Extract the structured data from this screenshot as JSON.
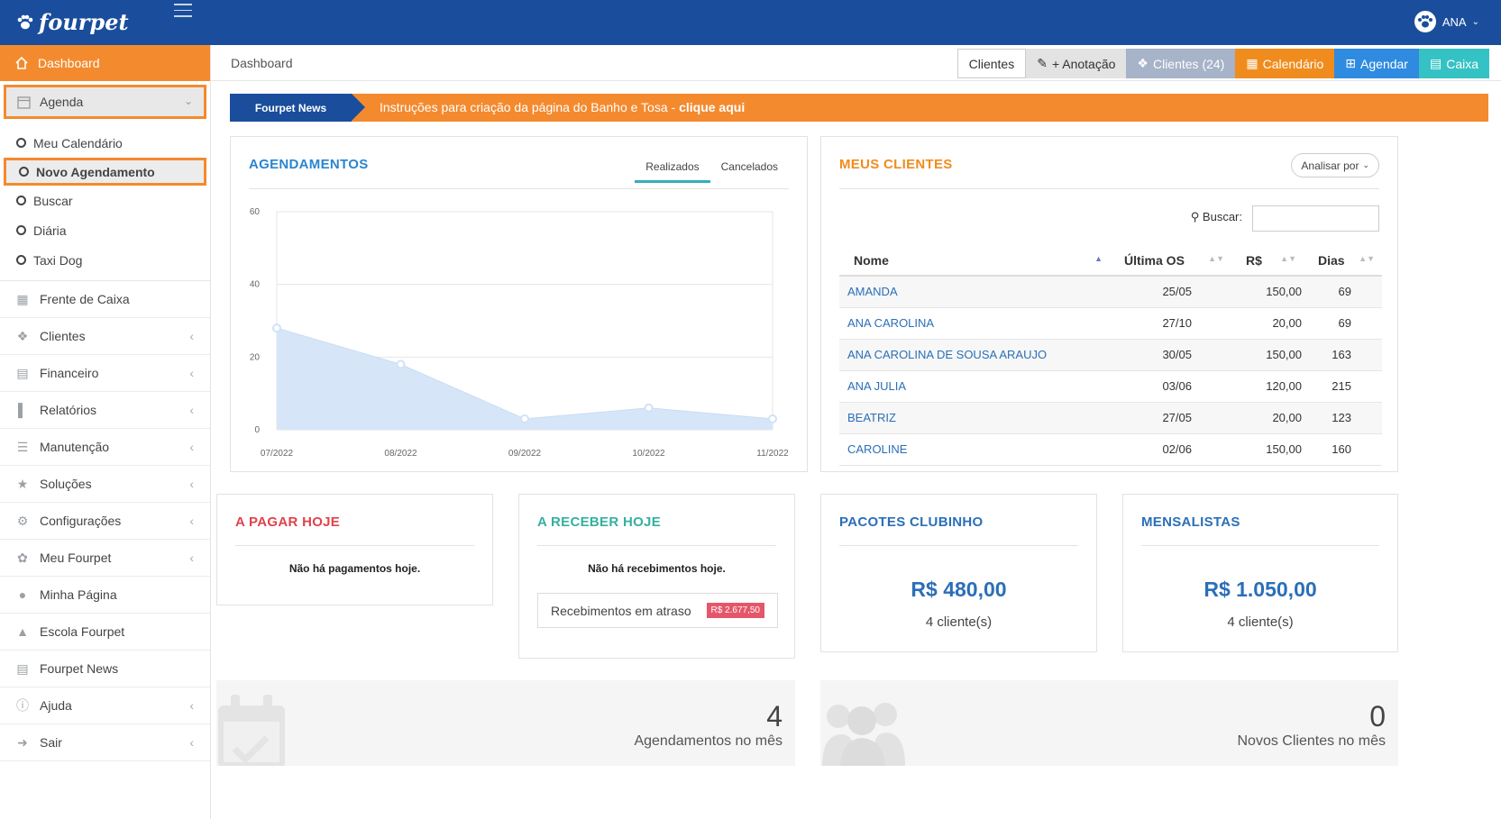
{
  "app": {
    "brand": "fourpet",
    "user": "ANA"
  },
  "sidebar": {
    "dashboard": "Dashboard",
    "agenda": "Agenda",
    "agenda_items": [
      "Meu Calendário",
      "Novo Agendamento",
      "Buscar",
      "Diária",
      "Taxi Dog"
    ],
    "menu": [
      {
        "label": "Frente de Caixa",
        "icon": "calculator-icon",
        "arrow": false
      },
      {
        "label": "Clientes",
        "icon": "users-icon",
        "arrow": true
      },
      {
        "label": "Financeiro",
        "icon": "money-icon",
        "arrow": true
      },
      {
        "label": "Relatórios",
        "icon": "bar-chart-icon",
        "arrow": true
      },
      {
        "label": "Manutenção",
        "icon": "database-icon",
        "arrow": true
      },
      {
        "label": "Soluções",
        "icon": "star-icon",
        "arrow": true
      },
      {
        "label": "Configurações",
        "icon": "cogs-icon",
        "arrow": true
      },
      {
        "label": "Meu Fourpet",
        "icon": "paw-icon",
        "arrow": true
      },
      {
        "label": "Minha Página",
        "icon": "globe-icon",
        "arrow": false
      },
      {
        "label": "Escola Fourpet",
        "icon": "graduation-cap-icon",
        "arrow": false
      },
      {
        "label": "Fourpet News",
        "icon": "newspaper-icon",
        "arrow": false
      },
      {
        "label": "Ajuda",
        "icon": "info-icon",
        "arrow": true
      },
      {
        "label": "Sair",
        "icon": "sign-out-icon",
        "arrow": true
      }
    ]
  },
  "header": {
    "breadcrumb": "Dashboard",
    "buttons": {
      "clientes": "Clientes",
      "anotacao": "+ Anotação",
      "clientes_count": "Clientes (24)",
      "calendario": "Calendário",
      "agendar": "Agendar",
      "caixa": "Caixa"
    }
  },
  "news": {
    "tag": "Fourpet News",
    "message": "Instruções para criação da página do Banho e Tosa - ",
    "link": "clique aqui"
  },
  "agendamentos": {
    "title": "AGENDAMENTOS",
    "tab_active": "Realizados",
    "tab_other": "Cancelados"
  },
  "chart_data": {
    "type": "area",
    "categories": [
      "07/2022",
      "08/2022",
      "09/2022",
      "10/2022",
      "11/2022"
    ],
    "values": [
      28,
      18,
      3,
      6,
      3
    ],
    "ylim": [
      0,
      60
    ],
    "yticks": [
      0,
      20,
      40,
      60
    ],
    "grid": true,
    "fill_color": "#d6e6f8",
    "point_color": "#cfe3f7"
  },
  "clientes": {
    "title": "MEUS CLIENTES",
    "analyze_label": "Analisar por",
    "search_label": "Buscar:",
    "search_value": "",
    "columns": [
      "Nome",
      "Última OS",
      "R$",
      "Dias"
    ],
    "rows": [
      {
        "nome": "AMANDA",
        "os": "25/05",
        "valor": "150,00",
        "dias": "69"
      },
      {
        "nome": "ANA CAROLINA",
        "os": "27/10",
        "valor": "20,00",
        "dias": "69"
      },
      {
        "nome": "ANA CAROLINA DE SOUSA ARAUJO",
        "os": "30/05",
        "valor": "150,00",
        "dias": "163"
      },
      {
        "nome": "ANA JULIA",
        "os": "03/06",
        "valor": "120,00",
        "dias": "215"
      },
      {
        "nome": "BEATRIZ",
        "os": "27/05",
        "valor": "20,00",
        "dias": "123"
      },
      {
        "nome": "CAROLINE",
        "os": "02/06",
        "valor": "150,00",
        "dias": "160"
      }
    ]
  },
  "pagar": {
    "title": "A PAGAR HOJE",
    "text": "Não há pagamentos hoje."
  },
  "receber": {
    "title": "A RECEBER HOJE",
    "text": "Não há recebimentos hoje.",
    "atraso_label": "Recebimentos em atraso",
    "atraso_value": "R$ 2.677,50"
  },
  "pacotes": {
    "title": "PACOTES CLUBINHO",
    "value": "R$ 480,00",
    "sub": "4 cliente(s)"
  },
  "mensalistas": {
    "title": "MENSALISTAS",
    "value": "R$ 1.050,00",
    "sub": "4 cliente(s)"
  },
  "stats": {
    "agendamentos": {
      "value": "4",
      "label": "Agendamentos no mês"
    },
    "novos": {
      "value": "0",
      "label": "Novos Clientes no mês"
    }
  },
  "colors": {
    "brand_blue": "#1a4e9c",
    "accent_orange": "#f48a2e",
    "red": "#e0424b",
    "teal": "#35b0a0",
    "link_blue": "#2a6fb8"
  }
}
